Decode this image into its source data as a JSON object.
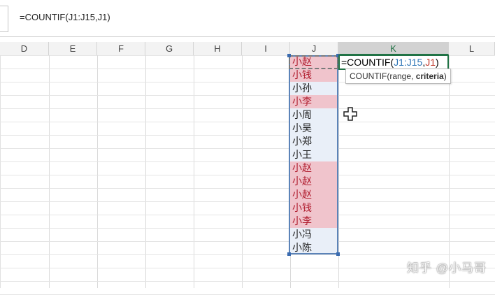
{
  "formula_bar": {
    "text": "=COUNTIF(J1:J15,J1)"
  },
  "columns": [
    {
      "label": "D"
    },
    {
      "label": "E"
    },
    {
      "label": "F"
    },
    {
      "label": "G"
    },
    {
      "label": "H"
    },
    {
      "label": "I"
    },
    {
      "label": "J"
    },
    {
      "label": "K",
      "active": true
    },
    {
      "label": "L"
    }
  ],
  "column_j_cells": [
    {
      "value": "小赵",
      "duplicate": true
    },
    {
      "value": "小钱",
      "duplicate": true
    },
    {
      "value": "小孙",
      "duplicate": false
    },
    {
      "value": "小李",
      "duplicate": true
    },
    {
      "value": "小周",
      "duplicate": false
    },
    {
      "value": "小吴",
      "duplicate": false
    },
    {
      "value": "小郑",
      "duplicate": false
    },
    {
      "value": "小王",
      "duplicate": false
    },
    {
      "value": "小赵",
      "duplicate": true
    },
    {
      "value": "小赵",
      "duplicate": true
    },
    {
      "value": "小赵",
      "duplicate": true
    },
    {
      "value": "小钱",
      "duplicate": true
    },
    {
      "value": "小李",
      "duplicate": true
    },
    {
      "value": "小冯",
      "duplicate": false
    },
    {
      "value": "小陈",
      "duplicate": false
    }
  ],
  "edit_cell": {
    "prefix": "=COUNTIF(",
    "ref1": "J1:J15",
    "sep": ",",
    "ref2": "J1",
    "suffix": ")"
  },
  "tooltip": {
    "func": "COUNTIF(range, ",
    "current_arg": "criteria",
    "close": ")"
  },
  "watermark": "知乎 @小马哥",
  "colors": {
    "duplicate_fill": "#f0c4cc",
    "duplicate_text": "#b01c2e",
    "selection_fill": "#e9eff8",
    "accent": "#217346"
  }
}
